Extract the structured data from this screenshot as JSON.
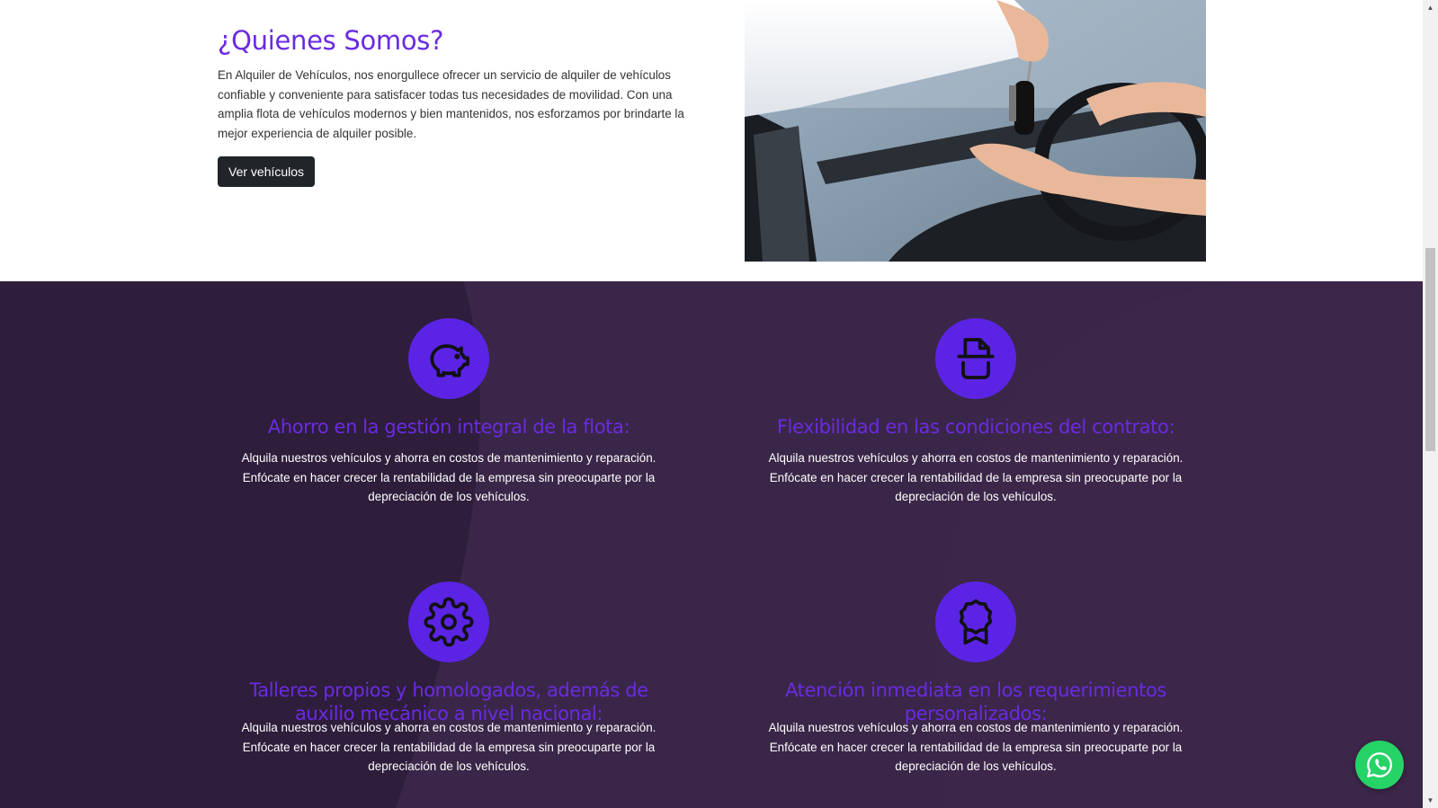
{
  "about": {
    "title": "¿Quienes Somos?",
    "text": "En Alquiler de Vehículos, nos enorgullece ofrecer un servicio de alquiler de vehículos confiable y conveniente para satisfacer todas tus necesidades de movilidad. Con una amplia flota de vehículos modernos y bien mantenidos, nos esforzamos por brindarte la mejor experiencia de alquiler posible.",
    "button_label": "Ver vehículos",
    "image_icon": "car-key-handover-photo"
  },
  "features": [
    {
      "icon": "piggy-bank-icon",
      "title": "Ahorro en la gestión integral de la flota:",
      "text": "Alquila nuestros vehículos y ahorra en costos de mantenimiento y reparación. Enfócate en hacer crecer la rentabilidad de la empresa sin preocuparte por la depreciación de los vehículos."
    },
    {
      "icon": "document-icon",
      "title": "Flexibilidad en las condiciones del contrato:",
      "text": "Alquila nuestros vehículos y ahorra en costos de mantenimiento y reparación. Enfócate en hacer crecer la rentabilidad de la empresa sin preocuparte por la depreciación de los vehículos."
    },
    {
      "icon": "gear-icon",
      "title": "Talleres propios y homologados, además de auxilio mecánico a nivel nacional:",
      "text": "Alquila nuestros vehículos y ahorra en costos de mantenimiento y reparación. Enfócate en hacer crecer la rentabilidad de la empresa sin preocuparte por la depreciación de los vehículos."
    },
    {
      "icon": "award-icon",
      "title": "Atención inmediata en los requerimientos personalizados:",
      "text": "Alquila nuestros vehículos y ahorra en costos de mantenimiento y reparación. Enfócate en hacer crecer la rentabilidad de la empresa sin preocuparte por la depreciación de los vehículos."
    }
  ],
  "floating": {
    "icon": "whatsapp-icon"
  },
  "colors": {
    "accent": "#6a2be0",
    "icon_circle": "#5b24e4",
    "section_bg": "#2e1d3b",
    "button_bg": "#212529",
    "whatsapp": "#25d366"
  }
}
